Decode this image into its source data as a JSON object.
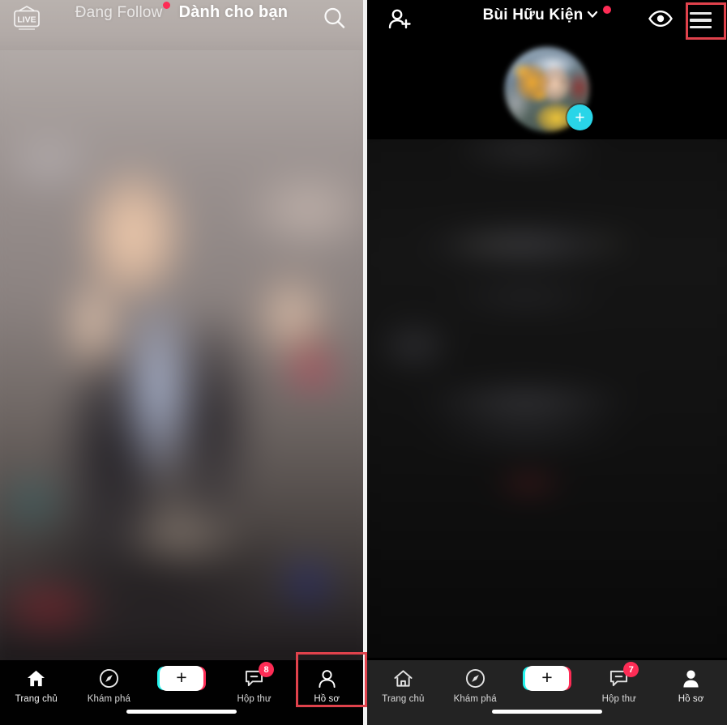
{
  "left_screen": {
    "name": "tiktok-feed-screen",
    "top_bar": {
      "live_label": "LIVE",
      "live_icon": "live-tv-icon",
      "tabs": [
        {
          "label": "Đang Follow",
          "active": false,
          "has_dot": true
        },
        {
          "label": "Dành cho bạn",
          "active": true,
          "has_dot": false
        }
      ],
      "search_icon": "search-icon"
    },
    "video": {
      "description_alt": "blurred-video-content"
    },
    "tab_bar": [
      {
        "label": "Trang chủ",
        "icon": "home-icon",
        "badge": null
      },
      {
        "label": "Khám phá",
        "icon": "compass-icon",
        "badge": null
      },
      {
        "label": "",
        "icon": "create-plus-icon",
        "badge": null
      },
      {
        "label": "Hộp thư",
        "icon": "inbox-message-icon",
        "badge": "8"
      },
      {
        "label": "Hồ sơ",
        "icon": "person-outline-icon",
        "badge": null
      }
    ],
    "highlight": "Hồ sơ"
  },
  "right_screen": {
    "name": "tiktok-profile-screen",
    "top_bar": {
      "add_friend_icon": "person-add-icon",
      "profile_name": "Bùi Hữu Kiện",
      "chevron_icon": "chevron-down-icon",
      "has_name_dot": true,
      "eye_icon": "eye-icon",
      "menu_icon": "hamburger-menu-icon"
    },
    "avatar": {
      "icon": "avatar",
      "add_badge": "+"
    },
    "tab_bar": [
      {
        "label": "Trang chủ",
        "icon": "home-icon",
        "badge": null
      },
      {
        "label": "Khám phá",
        "icon": "compass-icon",
        "badge": null
      },
      {
        "label": "",
        "icon": "create-plus-icon",
        "badge": null
      },
      {
        "label": "Hộp thư",
        "icon": "inbox-message-icon",
        "badge": "7"
      },
      {
        "label": "Hồ sơ",
        "icon": "person-filled-icon",
        "badge": null
      }
    ],
    "highlight": "hamburger-menu"
  },
  "colors": {
    "accent_red": "#fe2c55",
    "highlight_box": "#e0424c",
    "cyan": "#25f4ee",
    "avatar_badge": "#29d5e8",
    "nav_dark": "#010101",
    "nav_gray": "#232323"
  }
}
